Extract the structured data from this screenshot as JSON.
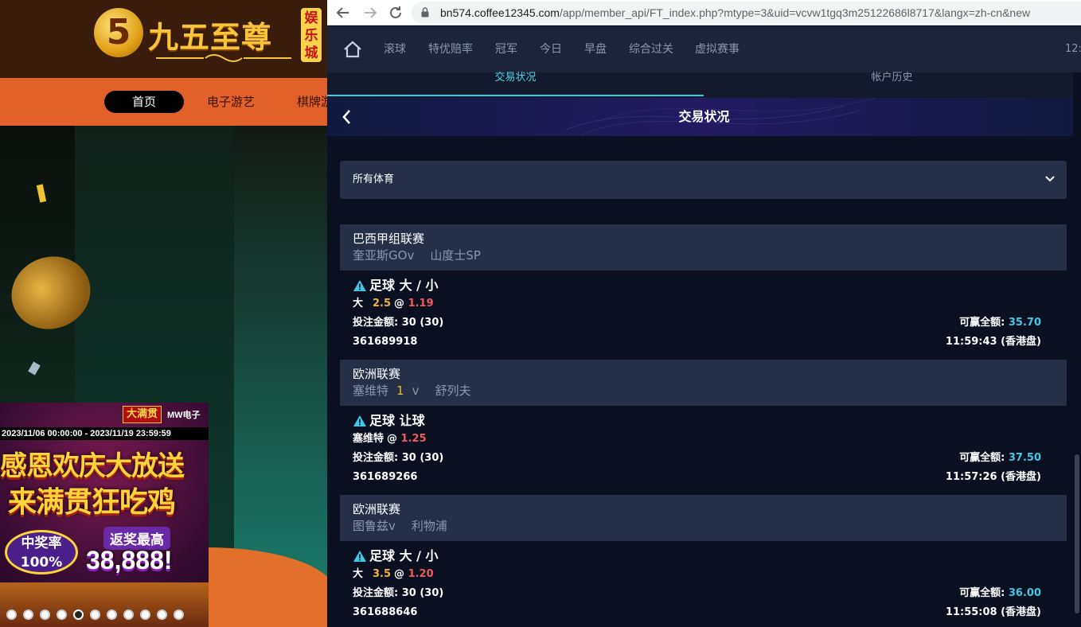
{
  "site": {
    "logo_mark": "5",
    "logo_text": "九五至尊",
    "logo_badge": "娱乐城",
    "nav": [
      "首页",
      "电子游艺",
      "棋牌游"
    ],
    "promo": {
      "brand": "大满贯",
      "brand2": "MW电子",
      "date": "2023/11/06 00:00:00 - 2023/11/19 23:59:59",
      "line1": "感恩欢庆大放送",
      "line2": "来满贯狂吃鸡",
      "rate": "中奖率100%",
      "return_label": "返奖最高",
      "amount": "38,888!"
    }
  },
  "browser": {
    "url_host": "bn574.coffee12345.com",
    "url_path": "/app/member_api/FT_index.php?mtype=3&uid=vcvw1tgq3m25122686l8717&langx=zh-cn&new"
  },
  "topnav": {
    "items": [
      "滚球",
      "特优赔率",
      "冠军",
      "今日",
      "早盘",
      "综合过关",
      "虚拟赛事"
    ],
    "time": "12:"
  },
  "subtabs": [
    "交易状况",
    "帐户历史"
  ],
  "page": {
    "title": "交易状况",
    "sport_filter": "所有体育",
    "labels": {
      "stake": "投注金额: ",
      "win": "可赢全额: ",
      "at": "@",
      "vs": "v"
    }
  },
  "bets": [
    {
      "league": "巴西甲组联赛",
      "home": "奎亚斯GO",
      "score": "",
      "away": "山度士SP",
      "bet_type": "足球 大 / 小",
      "selection": "大",
      "handicap": "2.5",
      "odds": "1.19",
      "stake": "30 (30)",
      "win": "35.70",
      "ticket_id": "361689918",
      "time": "11:59:43 (香港盘)"
    },
    {
      "league": "欧洲联赛",
      "home": "塞维特",
      "score": "1",
      "away": "舒列夫",
      "bet_type": "足球 让球",
      "selection": "塞维特",
      "handicap": "",
      "odds": "1.25",
      "stake": "30 (30)",
      "win": "37.50",
      "ticket_id": "361689266",
      "time": "11:57:26 (香港盘)"
    },
    {
      "league": "欧洲联赛",
      "home": "图鲁兹",
      "score": "",
      "away": "利物浦",
      "bet_type": "足球 大 / 小",
      "selection": "大",
      "handicap": "3.5",
      "odds": "1.20",
      "stake": "30 (30)",
      "win": "36.00",
      "ticket_id": "361688646",
      "time": "11:55:08 (香港盘)"
    }
  ],
  "colors": {
    "accent": "#3fc9e8",
    "odds": "#f05a5a",
    "handicap": "#f0b43a",
    "panel": "#253047",
    "background": "#0a1020"
  }
}
